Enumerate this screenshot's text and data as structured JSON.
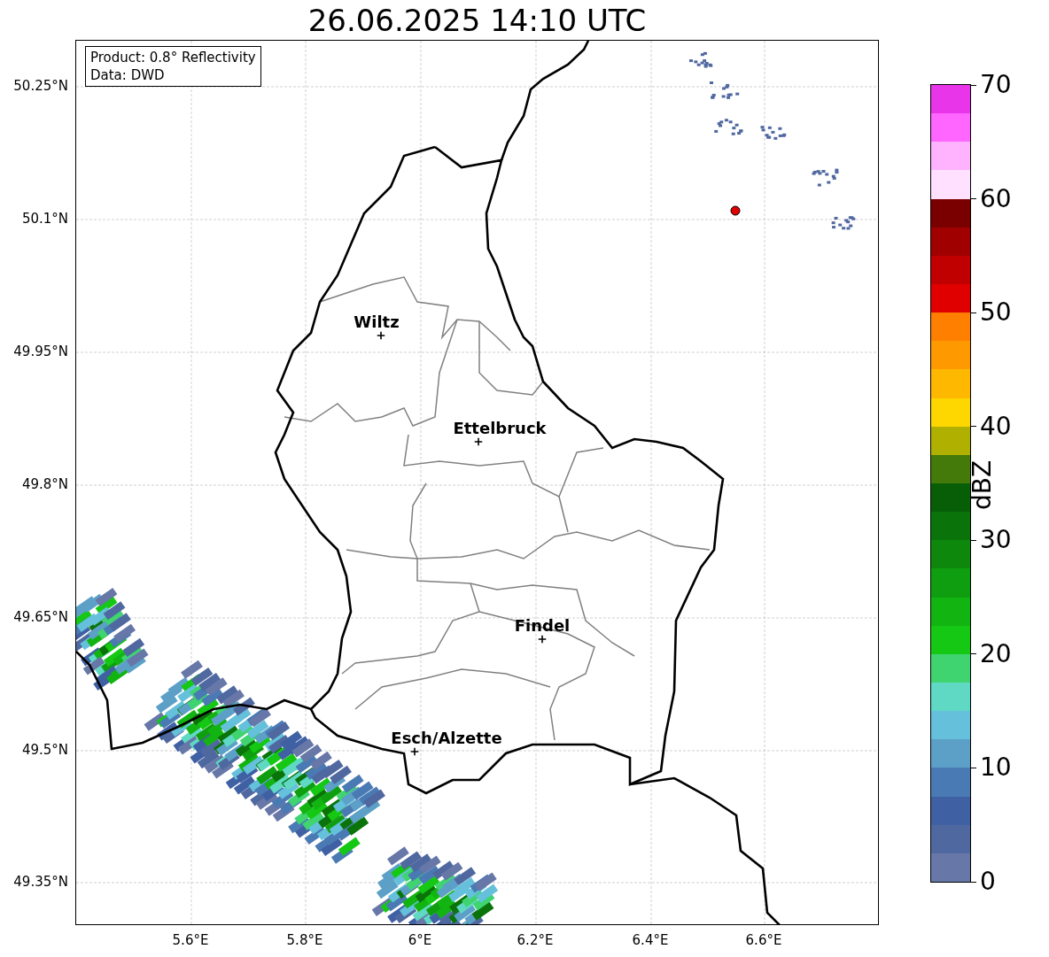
{
  "title": "26.06.2025 14:10 UTC",
  "info_box": {
    "lines": [
      "Product: 0.8° Reflectivity",
      "Data: DWD"
    ]
  },
  "lat_ticks": [
    "50.25°N",
    "50.1°N",
    "49.95°N",
    "49.8°N",
    "49.65°N",
    "49.5°N",
    "49.35°N"
  ],
  "lon_ticks": [
    "5.6°E",
    "5.8°E",
    "6°E",
    "6.2°E",
    "6.4°E",
    "6.6°E"
  ],
  "places": [
    {
      "name": "Wiltz"
    },
    {
      "name": "Ettelbruck"
    },
    {
      "name": "Findel"
    },
    {
      "name": "Esch/Alzette"
    }
  ],
  "colorbar": {
    "label": "dBZ",
    "ticks": [
      "70",
      "60",
      "50",
      "40",
      "30",
      "20",
      "10",
      "0"
    ],
    "bins": [
      {
        "color": "#6677a8"
      },
      {
        "color": "#5068a0"
      },
      {
        "color": "#4060a4"
      },
      {
        "color": "#4a7ab4"
      },
      {
        "color": "#5ca0c8"
      },
      {
        "color": "#64c0db"
      },
      {
        "color": "#5fd8c4"
      },
      {
        "color": "#3fd46f"
      },
      {
        "color": "#14c814"
      },
      {
        "color": "#12b412"
      },
      {
        "color": "#0f9e0f"
      },
      {
        "color": "#0d880d"
      },
      {
        "color": "#0a740a"
      },
      {
        "color": "#075e07"
      },
      {
        "color": "#447a0a"
      },
      {
        "color": "#b0b000"
      },
      {
        "color": "#ffd700"
      },
      {
        "color": "#ffb800"
      },
      {
        "color": "#ff9900"
      },
      {
        "color": "#ff7f00"
      },
      {
        "color": "#e00000"
      },
      {
        "color": "#c00000"
      },
      {
        "color": "#a00000"
      },
      {
        "color": "#7a0000"
      },
      {
        "color": "#ffe0ff"
      },
      {
        "color": "#ffb3ff"
      },
      {
        "color": "#ff66ff"
      },
      {
        "color": "#e935e9"
      }
    ]
  }
}
